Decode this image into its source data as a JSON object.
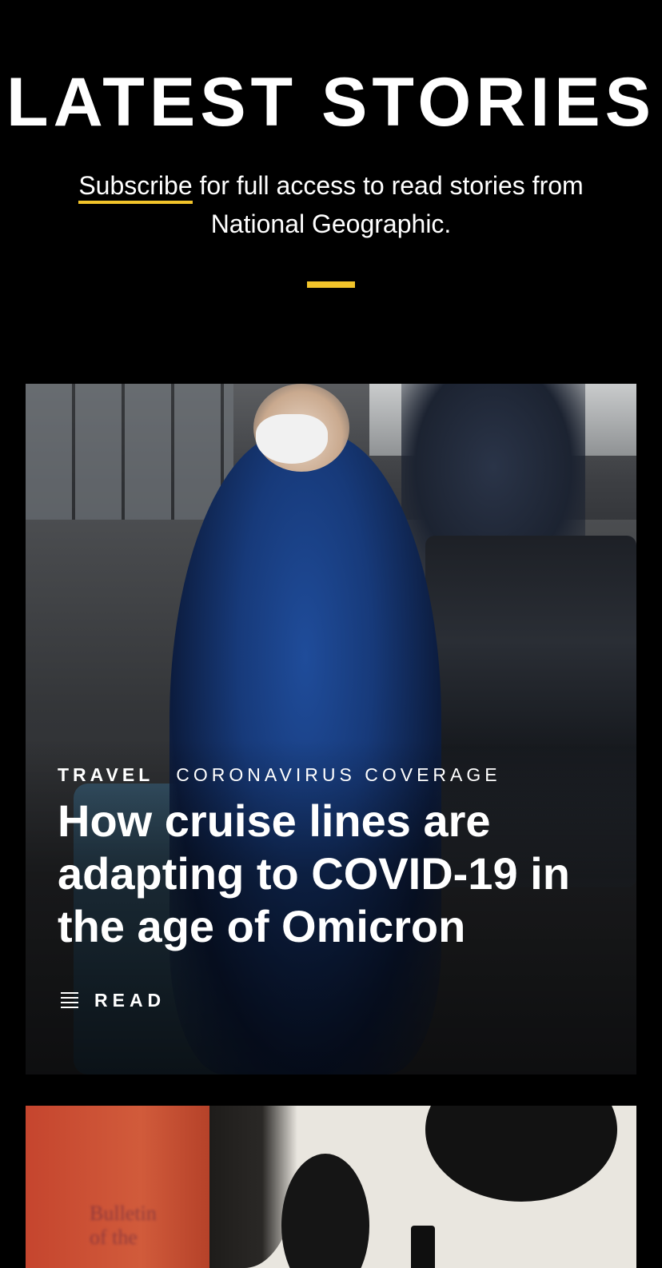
{
  "header": {
    "title": "LATEST STORIES",
    "subscribe_link": "Subscribe",
    "subscribe_text": " for full access to read stories from National Geographic."
  },
  "colors": {
    "accent": "#f2c42a",
    "background": "#000000",
    "text": "#ffffff"
  },
  "stories": [
    {
      "kicker_primary": "TRAVEL",
      "kicker_secondary": "CORONAVIRUS COVERAGE",
      "headline": "How cruise lines are adapting to COVID-19 in the age of Omicron",
      "action_label": "READ",
      "action_icon": "article-lines-icon"
    }
  ],
  "story2_image_text": "Bulletin\nof the"
}
